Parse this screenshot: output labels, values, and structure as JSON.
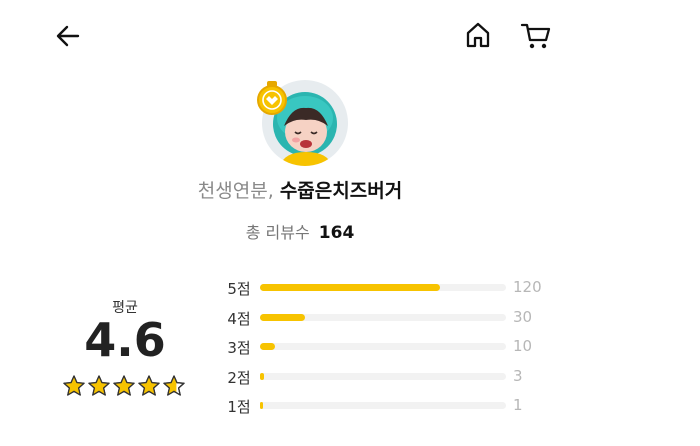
{
  "header": {
    "back_icon": "back-arrow-icon",
    "home_icon": "home-icon",
    "cart_icon": "cart-icon"
  },
  "profile": {
    "store_prefix": "천생연분,",
    "store_name": "수줍은치즈버거",
    "review_count_label": "총 리뷰수",
    "review_count": "164",
    "badge_color": "#f7c300",
    "avatar_hair_color": "#2bb5b0"
  },
  "rating": {
    "average_label": "평균",
    "average": "4.6",
    "stars_value": 4.6,
    "stars_total": 5,
    "star_color": "#f7c300"
  },
  "distribution": {
    "bar_color": "#f7c300",
    "track_color": "#f2f2f2",
    "max": 164,
    "rows": [
      {
        "label": "5점",
        "count": 120
      },
      {
        "label": "4점",
        "count": 30
      },
      {
        "label": "3점",
        "count": 10
      },
      {
        "label": "2점",
        "count": 3
      },
      {
        "label": "1점",
        "count": 1
      }
    ]
  }
}
